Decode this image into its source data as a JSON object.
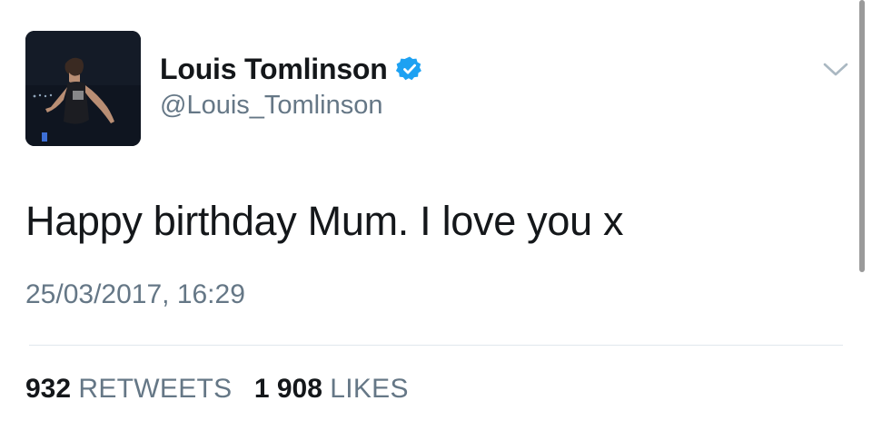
{
  "tweet": {
    "author": {
      "display_name": "Louis Tomlinson",
      "handle": "@Louis_Tomlinson",
      "verified": true,
      "avatar_icon": "profile-photo"
    },
    "text": "Happy birthday Mum. I love you x",
    "timestamp": "25/03/2017, 16:29",
    "stats": {
      "retweets_count": "932",
      "retweets_label": "RETWEETS",
      "likes_count": "1 908",
      "likes_label": "LIKES"
    },
    "menu_icon": "chevron-down-icon"
  },
  "colors": {
    "verified_badge": "#1da1f2",
    "text_primary": "#14171a",
    "text_secondary": "#657786",
    "divider": "#e1e8ed"
  }
}
